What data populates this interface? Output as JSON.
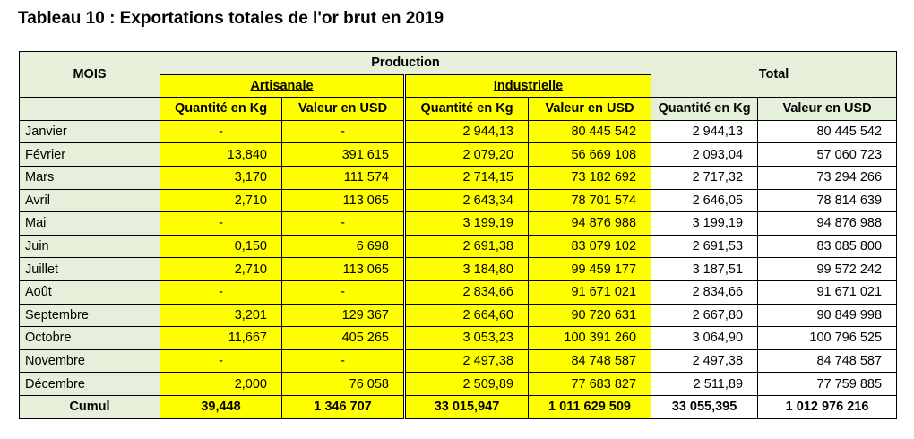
{
  "title": "Tableau 10 : Exportations totales de l'or brut en 2019",
  "headers": {
    "mois": "MOIS",
    "production": "Production",
    "artisanale": "Artisanale",
    "industrielle": "Industrielle",
    "total": "Total",
    "quantite": "Quantité en Kg",
    "valeur": "Valeur en USD"
  },
  "rows": [
    {
      "mois": "Janvier",
      "art_q": "-",
      "art_v": "-",
      "ind_q": "2 944,13",
      "ind_v": "80 445 542",
      "tot_q": "2 944,13",
      "tot_v": "80 445 542"
    },
    {
      "mois": "Février",
      "art_q": "13,840",
      "art_v": "391 615",
      "ind_q": "2 079,20",
      "ind_v": "56 669 108",
      "tot_q": "2 093,04",
      "tot_v": "57 060 723"
    },
    {
      "mois": "Mars",
      "art_q": "3,170",
      "art_v": "111 574",
      "ind_q": "2 714,15",
      "ind_v": "73 182 692",
      "tot_q": "2 717,32",
      "tot_v": "73 294 266"
    },
    {
      "mois": "Avril",
      "art_q": "2,710",
      "art_v": "113 065",
      "ind_q": "2 643,34",
      "ind_v": "78 701 574",
      "tot_q": "2 646,05",
      "tot_v": "78 814 639"
    },
    {
      "mois": "Mai",
      "art_q": "-",
      "art_v": "-",
      "ind_q": "3 199,19",
      "ind_v": "94 876 988",
      "tot_q": "3 199,19",
      "tot_v": "94 876 988"
    },
    {
      "mois": "Juin",
      "art_q": "0,150",
      "art_v": "6 698",
      "ind_q": "2 691,38",
      "ind_v": "83 079 102",
      "tot_q": "2 691,53",
      "tot_v": "83 085 800"
    },
    {
      "mois": "Juillet",
      "art_q": "2,710",
      "art_v": "113 065",
      "ind_q": "3 184,80",
      "ind_v": "99 459 177",
      "tot_q": "3 187,51",
      "tot_v": "99 572 242"
    },
    {
      "mois": "Août",
      "art_q": "-",
      "art_v": "-",
      "ind_q": "2 834,66",
      "ind_v": "91 671 021",
      "tot_q": "2 834,66",
      "tot_v": "91 671 021"
    },
    {
      "mois": "Septembre",
      "art_q": "3,201",
      "art_v": "129 367",
      "ind_q": "2 664,60",
      "ind_v": "90 720 631",
      "tot_q": "2 667,80",
      "tot_v": "90 849 998"
    },
    {
      "mois": "Octobre",
      "art_q": "11,667",
      "art_v": "405 265",
      "ind_q": "3 053,23",
      "ind_v": "100 391 260",
      "tot_q": "3 064,90",
      "tot_v": "100 796 525"
    },
    {
      "mois": "Novembre",
      "art_q": "-",
      "art_v": "-",
      "ind_q": "2 497,38",
      "ind_v": "84 748 587",
      "tot_q": "2 497,38",
      "tot_v": "84 748 587"
    },
    {
      "mois": "Décembre",
      "art_q": "2,000",
      "art_v": "76 058",
      "ind_q": "2 509,89",
      "ind_v": "77 683 827",
      "tot_q": "2 511,89",
      "tot_v": "77 759 885"
    }
  ],
  "cumul": {
    "mois": "Cumul",
    "art_q": "39,448",
    "art_v": "1 346 707",
    "ind_q": "33 015,947",
    "ind_v": "1 011 629 509",
    "tot_q": "33 055,395",
    "tot_v": "1 012 976 216"
  },
  "colors": {
    "header_green": "#e6efd9",
    "highlight_yellow": "#ffff00"
  }
}
